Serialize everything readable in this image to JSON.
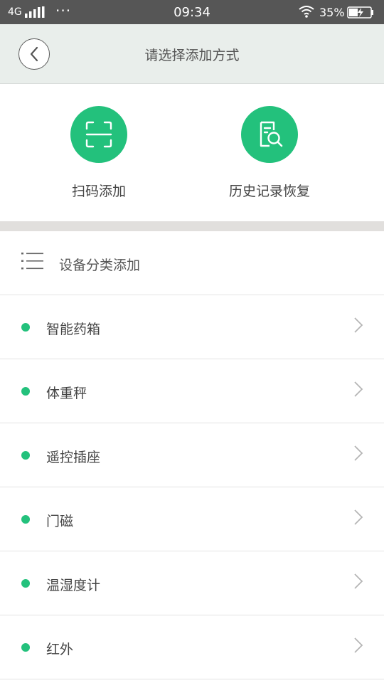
{
  "status_bar": {
    "network": "4G",
    "time": "09:34",
    "battery": "35%"
  },
  "header": {
    "title": "请选择添加方式"
  },
  "quick_add": {
    "scan_label": "扫码添加",
    "history_label": "历史记录恢复"
  },
  "category": {
    "title": "设备分类添加"
  },
  "devices": [
    {
      "label": "智能药箱"
    },
    {
      "label": "体重秤"
    },
    {
      "label": "遥控插座"
    },
    {
      "label": "门磁"
    },
    {
      "label": "温湿度计"
    },
    {
      "label": "红外"
    }
  ],
  "colors": {
    "accent": "#23c17c",
    "header_bg": "#e9eeeb",
    "status_bar_bg": "#565656"
  }
}
